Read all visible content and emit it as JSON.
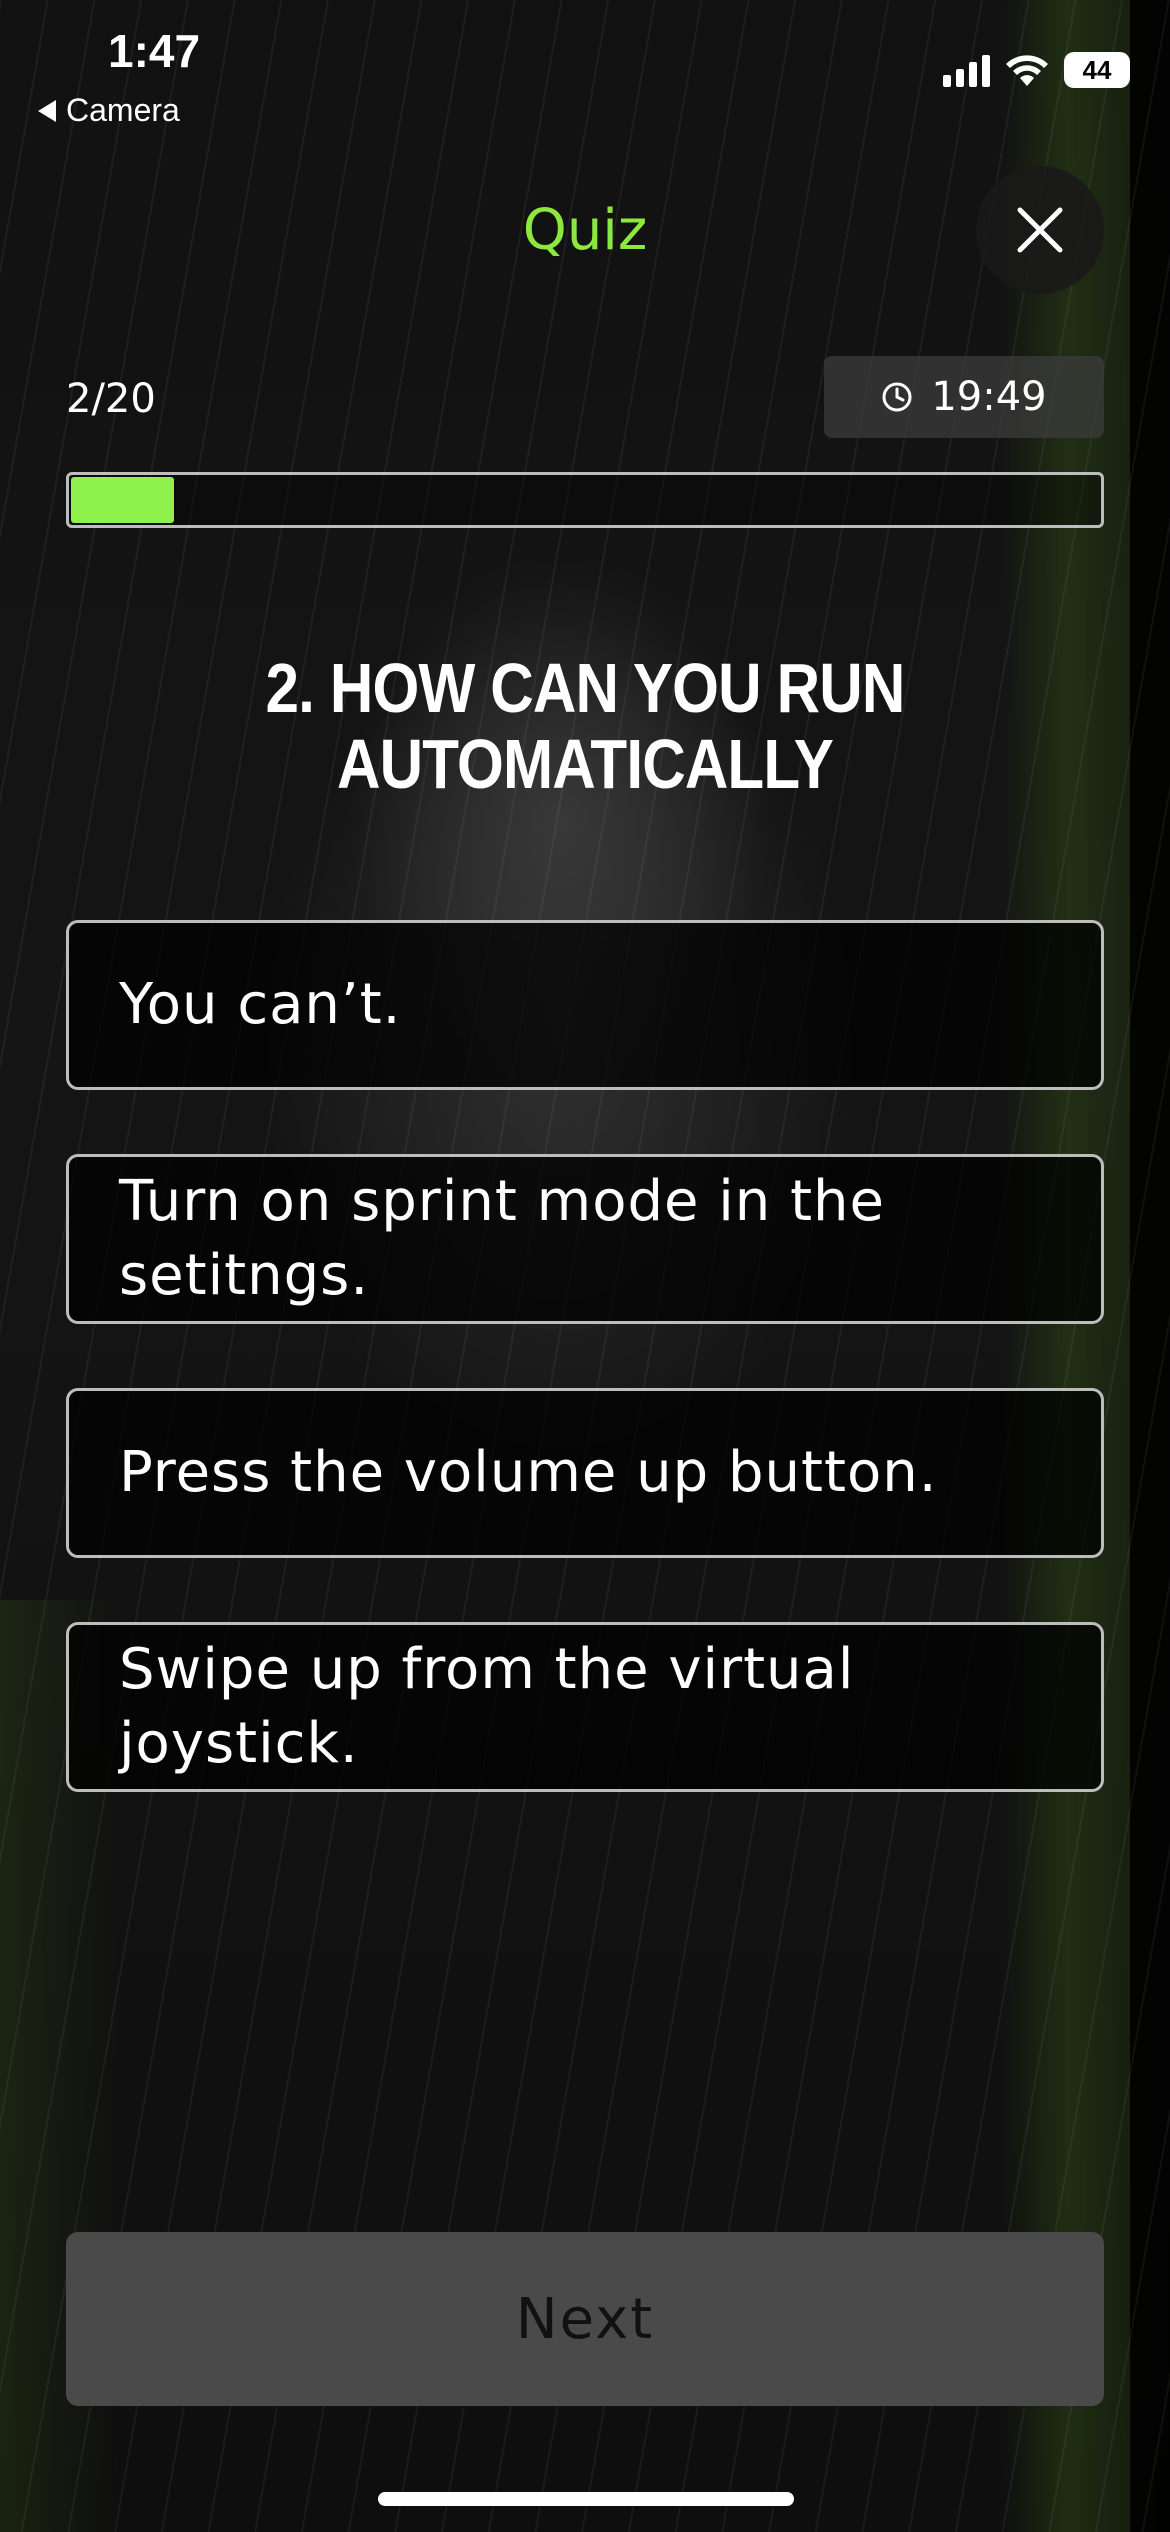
{
  "status_bar": {
    "time": "1:47",
    "back_label": "Camera",
    "battery": "44"
  },
  "header": {
    "title": "Quiz",
    "title_color": "#8ce83f"
  },
  "progress": {
    "label": "2/20",
    "fraction": 0.1,
    "fill_color": "#8ff14b"
  },
  "timer": {
    "value": "19:49",
    "icon": "clock-icon"
  },
  "question": {
    "text": "2. HOW CAN YOU RUN AUTOMATICALLY"
  },
  "options": [
    {
      "label": "You can’t."
    },
    {
      "label": "Turn on sprint mode in the setitngs."
    },
    {
      "label": "Press the volume up button."
    },
    {
      "label": "Swipe up from the virtual joystick."
    }
  ],
  "footer": {
    "next_label": "Next"
  }
}
